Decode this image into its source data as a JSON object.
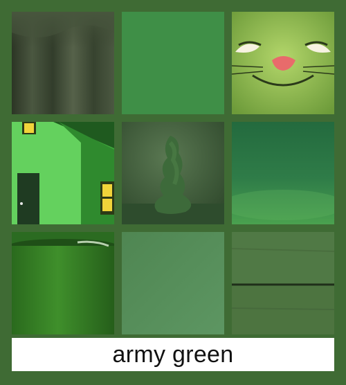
{
  "caption": "army green",
  "colors": {
    "background": "#3f6b34",
    "caption_bg": "#ffffff",
    "caption_text": "#111111"
  },
  "tiles": [
    {
      "name": "fabric-drape-photo",
      "color": "#3a4530"
    },
    {
      "name": "solid-green-swatch",
      "color": "#3f8f47"
    },
    {
      "name": "cartoon-cat-face-photo",
      "color": "#86b04a"
    },
    {
      "name": "green-house-painting",
      "color": "#55c94e"
    },
    {
      "name": "moss-sculpture-photo",
      "color": "#3b5a36"
    },
    {
      "name": "green-gradient-texture",
      "color": "#2f7a46"
    },
    {
      "name": "green-mug-photo",
      "color": "#2f7a22"
    },
    {
      "name": "sage-green-swatch",
      "color": "#558a59"
    },
    {
      "name": "wood-plank-photo",
      "color": "#4d7440"
    }
  ]
}
